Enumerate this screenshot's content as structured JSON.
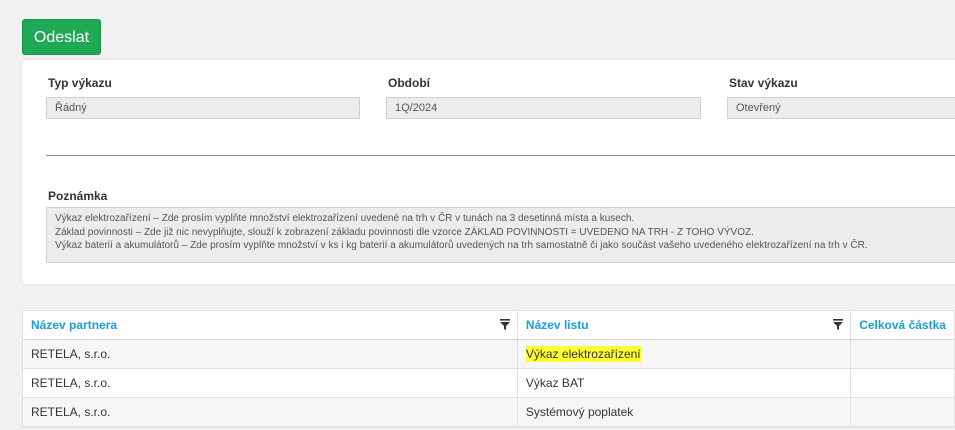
{
  "toolbar": {
    "send_label": "Odeslat"
  },
  "form": {
    "report_type_label": "Typ výkazu",
    "report_type_value": "Řádný",
    "period_label": "Období",
    "period_value": "1Q/2024",
    "status_label": "Stav výkazu",
    "status_value": "Otevřený",
    "note_label": "Poznámka",
    "note_lines": [
      "Výkaz elektrozařízení – Zde prosím vyplňte množství elektrozařízení uvedené na trh v ČR v tunách na 3 desetinná místa a kusech.",
      "Základ povinnosti – Zde již nic nevyplňujte, slouží k zobrazení základu povinnosti dle vzorce ZÁKLAD POVINNOSTI = UVEDENO NA TRH - Z TOHO VÝVOZ.",
      "Výkaz baterií a akumulátorů – Zde prosím vyplňte množství v ks i kg baterií a akumulátorů uvedených na trh samostatně či jako součást vašeho uvedeného elektrozařízení na trh v ČR."
    ]
  },
  "grid": {
    "columns": [
      "Název partnera",
      "Název listu",
      "Celková částka"
    ],
    "rows": [
      {
        "partner": "RETELA, s.r.o.",
        "sheet": "Výkaz elektrozařízení",
        "amount": ""
      },
      {
        "partner": "RETELA, s.r.o.",
        "sheet": "Výkaz BAT",
        "amount": ""
      },
      {
        "partner": "RETELA, s.r.o.",
        "sheet": "Systémový poplatek",
        "amount": ""
      }
    ]
  },
  "colors": {
    "accent_green": "#1fa855",
    "header_blue": "#1a9fd9",
    "highlight": "#ffff33"
  }
}
